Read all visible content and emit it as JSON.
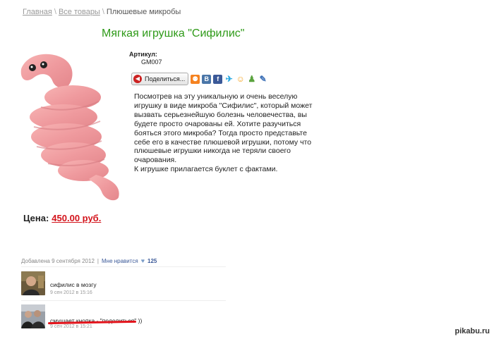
{
  "breadcrumb": {
    "home": "Главная",
    "all": "Все товары",
    "current": "Плюшевые микробы",
    "separator": "\\"
  },
  "product": {
    "title": "Мягкая игрушка \"Сифилис\"",
    "article_label": "Артикул:",
    "article_value": "GM007",
    "share_label": "Поделиться...",
    "description": "Посмотрев на эту уникальную и очень веселую\nигрушку в виде микроба \"Сифилис\", который может\nвызвать серьезнейшую болезнь человечества, вы\nбудете просто очарованы ей. Хотите разучиться\nбояться этого микроба? Тогда просто представьте\nсебе его в качестве плюшевой игрушки, потому что\nплюшевые игрушки никогда не теряли своего\nочарования.\nК игрушке прилагается буклет с фактами.",
    "price_label": "Цена:",
    "price_value": "450.00 руб."
  },
  "share_icons": [
    "odnoklassniki-icon",
    "vk-icon",
    "facebook-icon",
    "twitter-icon",
    "mail-icon",
    "people-icon",
    "pencil-icon"
  ],
  "meta": {
    "added": "Добавлена 9 сентября 2012",
    "divider": "|",
    "like_label": "Мне нравится",
    "like_count": "125"
  },
  "comments": [
    {
      "text": "сифилис в мозгу",
      "time": "9 сен 2012 в 15:16"
    },
    {
      "text": "смущает кнопка - \"поделиться\" ))",
      "time": "9 сен 2012 в 15:21"
    }
  ],
  "watermark": "pikabu.ru",
  "colors": {
    "title": "#2e9a18",
    "price": "#d3131b",
    "link": "#3b5998",
    "highlight": "#e3141c"
  }
}
